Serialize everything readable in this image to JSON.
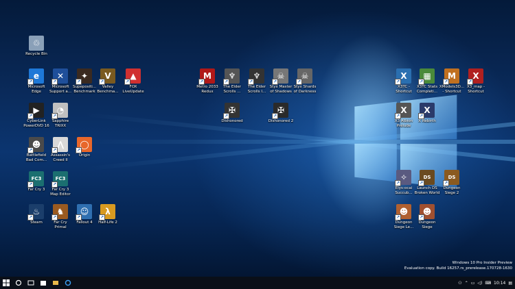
{
  "desktop": {
    "icons": [
      {
        "label": "Recycle Bin",
        "glyph": "♲",
        "color": "#8aa0b8",
        "icon": "recycle-bin-icon"
      },
      {
        "label": "Microsoft\nEdge",
        "glyph": "e",
        "color": "#1e78d7",
        "icon": "edge-icon"
      },
      {
        "label": "Microsoft\nSupport a...",
        "glyph": "✕",
        "color": "#1f4f9a",
        "icon": "support-icon"
      },
      {
        "label": "Supepositi...\nBenchmark",
        "glyph": "✦",
        "color": "#3a2a20",
        "icon": "superposition-icon"
      },
      {
        "label": "Valley\nBenchma...",
        "glyph": "V",
        "color": "#7a5a20",
        "icon": "valley-icon"
      },
      {
        "label": "FOX\nLiveUpdate",
        "glyph": "▲",
        "color": "#d03030",
        "icon": "fox-icon"
      },
      {
        "label": "CyberLink\nPowerDVD 16",
        "glyph": "▶",
        "color": "#222",
        "icon": "powerdvd-icon"
      },
      {
        "label": "Sapphire\nTRIXX",
        "glyph": "◔",
        "color": "#c0c0c0",
        "icon": "trixx-icon"
      },
      {
        "label": "Battlefield\nBad Com...",
        "glyph": "☻",
        "color": "#4a4a4a",
        "icon": "battlefield-icon"
      },
      {
        "label": "Assassin's\nCreed II",
        "glyph": "⋀",
        "color": "#d8d8d8",
        "icon": "assassins-creed-icon"
      },
      {
        "label": "Origin",
        "glyph": "◯",
        "color": "#e8672a",
        "icon": "origin-icon"
      },
      {
        "label": "Far Cry 3",
        "glyph": "FC3",
        "color": "#1b6f70",
        "icon": "farcry3-icon"
      },
      {
        "label": "Far Cry 3\nMap Editor",
        "glyph": "FC3",
        "color": "#1b6f70",
        "icon": "farcry3-editor-icon"
      },
      {
        "label": "Steam",
        "glyph": "♨",
        "color": "#1b3e6b",
        "icon": "steam-icon"
      },
      {
        "label": "Far Cry\nPrimal",
        "glyph": "♞",
        "color": "#9a5a20",
        "icon": "farcry-primal-icon"
      },
      {
        "label": "Fallout 4",
        "glyph": "☺",
        "color": "#2f6fb0",
        "icon": "fallout4-icon"
      },
      {
        "label": "Half-Life 2",
        "glyph": "λ",
        "color": "#d89a20",
        "icon": "halflife2-icon"
      },
      {
        "label": "Metro 2033\nRedux",
        "glyph": "M",
        "color": "#b01818",
        "icon": "metro-icon"
      },
      {
        "label": "The Elder\nScrolls ...",
        "glyph": "♆",
        "color": "#555",
        "icon": "elder-scrolls-icon"
      },
      {
        "label": "The Elder\nScrolls I...",
        "glyph": "♆",
        "color": "#333",
        "icon": "elder-scrolls-2-icon"
      },
      {
        "label": "Styx Master\nof Shadows",
        "glyph": "☠",
        "color": "#777",
        "icon": "styx-icon"
      },
      {
        "label": "Styx Shards\nof Darkness",
        "glyph": "☠",
        "color": "#666",
        "icon": "styx-shards-icon"
      },
      {
        "label": "Dishonored",
        "glyph": "✠",
        "color": "#333",
        "icon": "dishonored-icon"
      },
      {
        "label": "Dishonored 2",
        "glyph": "✠",
        "color": "#2a2a2a",
        "icon": "dishonored2-icon"
      },
      {
        "label": "X3TC -\nShortcut",
        "glyph": "X",
        "color": "#2a6fb0",
        "icon": "x3tc-icon"
      },
      {
        "label": "X3TC Stats\nCompleti...",
        "glyph": "▦",
        "color": "#4a8a3a",
        "icon": "x3tc-stats-icon"
      },
      {
        "label": "XModels3D...\n- Shortcut",
        "glyph": "M",
        "color": "#c07020",
        "icon": "xmodels-icon"
      },
      {
        "label": "X3_map -\nShortcut",
        "glyph": "X",
        "color": "#b02020",
        "icon": "x3map-icon"
      },
      {
        "label": "X3 Albion\nPrelude",
        "glyph": "X",
        "color": "#555",
        "icon": "x3-albion-icon"
      },
      {
        "label": "X Rebirth",
        "glyph": "X",
        "color": "#2a3a6a",
        "icon": "x-rebirth-icon"
      },
      {
        "label": "Elys-ocai\nSuccub...",
        "glyph": "✧",
        "color": "#5a5a80",
        "icon": "elysocai-icon"
      },
      {
        "label": "Launch DS\nBroken World",
        "glyph": "DS",
        "color": "#6a4a20",
        "icon": "ds-broken-icon"
      },
      {
        "label": "Dungeon\nSiege 2",
        "glyph": "DS",
        "color": "#8a5a20",
        "icon": "ds2-icon"
      },
      {
        "label": "Dungeon\nSiege Le...",
        "glyph": "☻",
        "color": "#b06030",
        "icon": "ds-legends-icon"
      },
      {
        "label": "Dungeon\nSiege",
        "glyph": "☻",
        "color": "#a05030",
        "icon": "dungeon-siege-icon"
      }
    ]
  },
  "watermark": {
    "line1": "Windows 10 Pro Insider Preview",
    "line2": "Evaluation copy. Build 16257.rs_prerelease.170728-1630"
  },
  "taskbar": {
    "clock": "10:14"
  }
}
